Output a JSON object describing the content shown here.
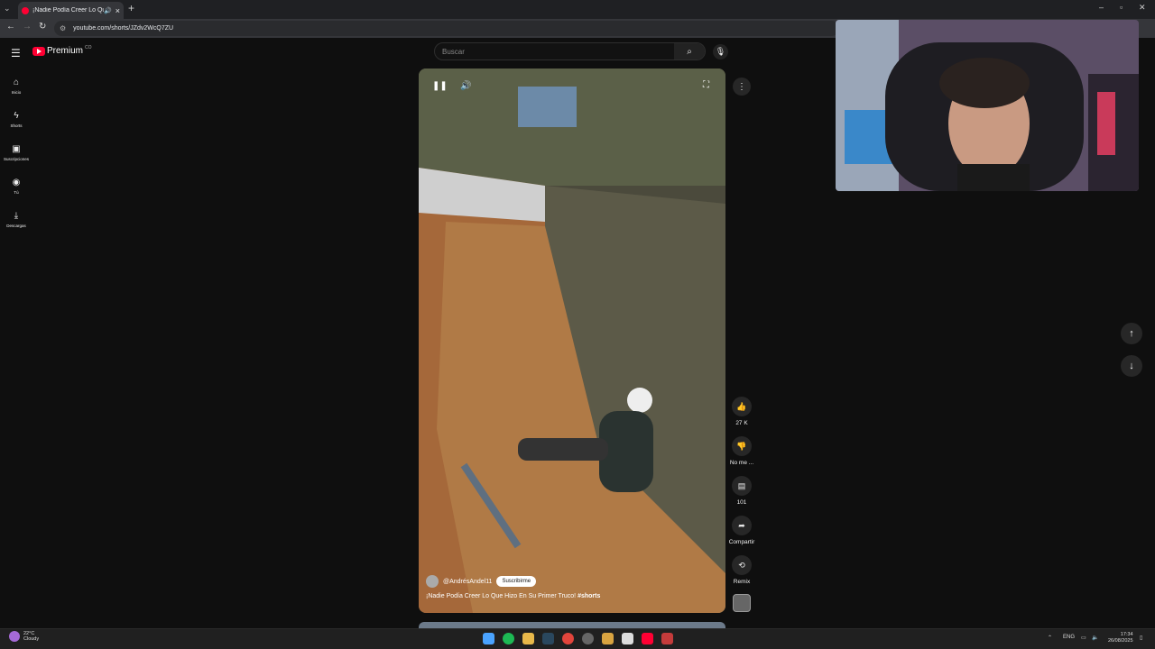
{
  "browser": {
    "tab_title": "¡Nadie Podía Creer Lo Que",
    "url": "youtube.com/shorts/JZdv2WcQ7ZU"
  },
  "youtube": {
    "logo_text": "Premium",
    "logo_sup": "CO",
    "search_placeholder": "Buscar",
    "sidebar": [
      {
        "icon": "home-icon",
        "label": "Inicio"
      },
      {
        "icon": "shorts-icon",
        "label": "Shorts"
      },
      {
        "icon": "subscriptions-icon",
        "label": "Suscripciones"
      },
      {
        "icon": "account-icon",
        "label": "Tú"
      },
      {
        "icon": "download-icon",
        "label": "Descargas"
      }
    ],
    "short": {
      "channel": "@AndrésAndel11",
      "subscribe_label": "Suscribirme",
      "title": "¡Nadie Podía Creer Lo Que Hizo En Su Primer Truco! ",
      "hashtag": "#shorts"
    },
    "actions": {
      "like_count": "27 K",
      "dislike_label": "No me ...",
      "comment_count": "101",
      "share_label": "Compartir",
      "remix_label": "Remix"
    }
  },
  "taskbar": {
    "weather_temp": "22°C",
    "weather_desc": "Cloudy",
    "lang": "ENG",
    "time": "17:34",
    "date": "26/08/2025"
  },
  "colors": {
    "brand_red": "#ff0033",
    "background": "#0f0f0f"
  }
}
